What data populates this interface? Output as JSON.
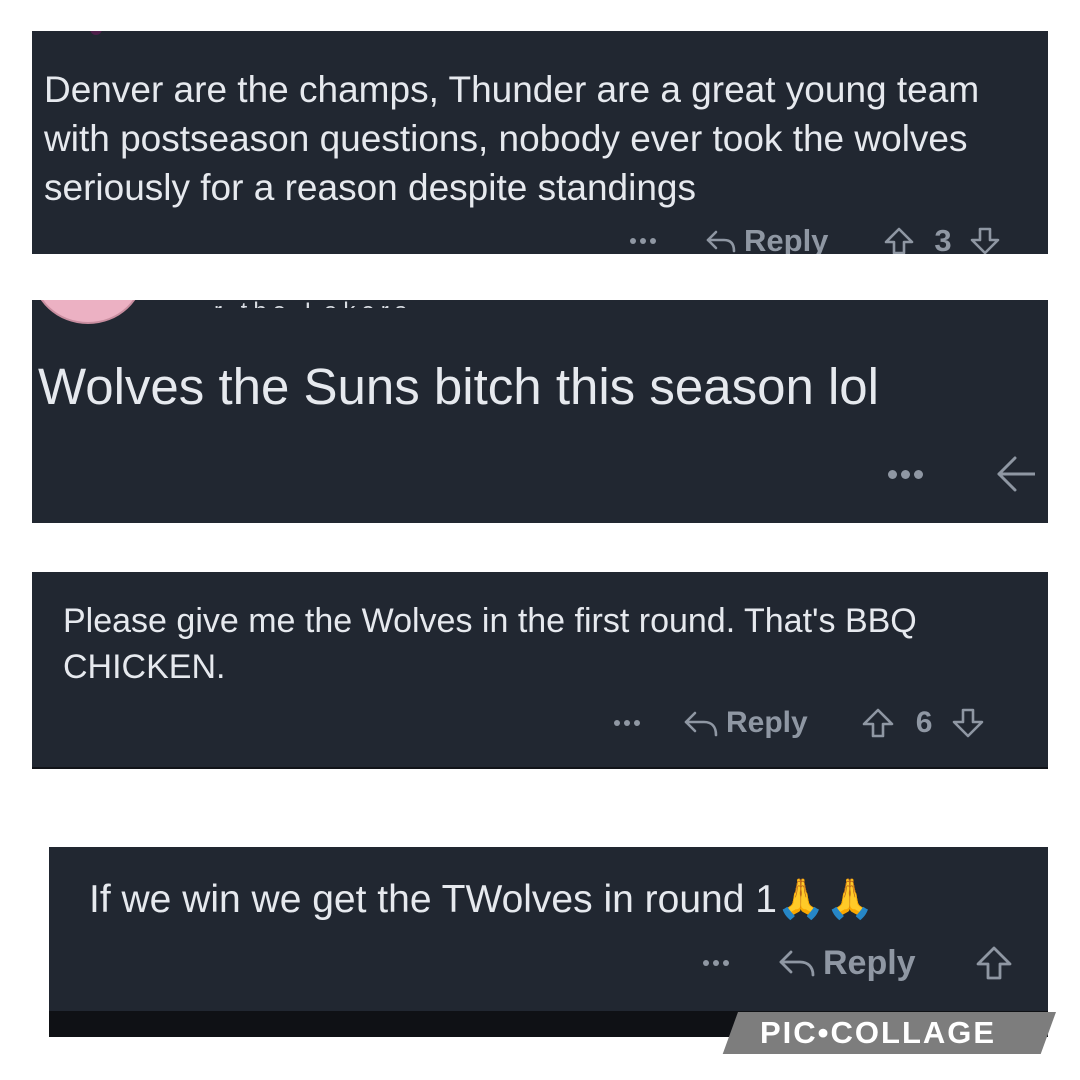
{
  "comments": [
    {
      "text": "Denver are the champs, Thunder are a great young team with postseason questions, nobody ever took the wolves seriously for a reason despite standings",
      "reply_label": "Reply",
      "vote_count": "3"
    },
    {
      "text": "Wolves the Suns bitch this season lol",
      "cropped_username": "r the Lakers"
    },
    {
      "text": "Please give me the Wolves in the first round. That's BBQ CHICKEN.",
      "reply_label": "Reply",
      "vote_count": "6"
    },
    {
      "text": "If we win we get the TWolves in round 1🙏🙏",
      "reply_label": "Reply"
    }
  ],
  "watermark": {
    "text": "PIC•COLLAGE"
  },
  "colors": {
    "panel_background": "#212731",
    "page_background": "#ffffff",
    "action_gray": "#8f97a3",
    "text": "#e6e9ee"
  }
}
